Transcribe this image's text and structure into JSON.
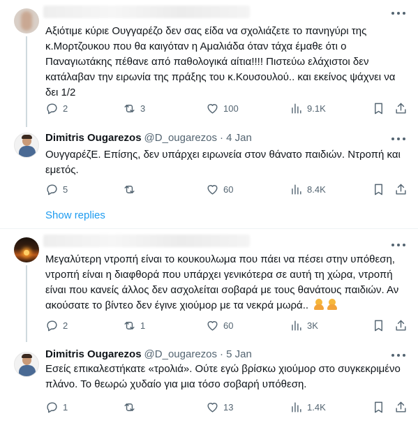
{
  "tweets": [
    {
      "name": "",
      "handle": "",
      "date": "",
      "text": "Αξιότιμε κύριε Ουγγαρέζο δεν σας είδα να σχολιάζετε το πανηγύρι της κ.Μορτζουκου που θα καιγόταν η Αμαλιάδα όταν τάχα έμαθε ότι ο Παναγιωτάκης πέθανε από παθολογικά αίτια!!!! Πιστεύω ελάχιστοι δεν κατάλαβαν την ειρωνία της πράξης του κ.Κουσουλού.. και εκείνος ψάχνει να δει 1/2",
      "replies": "2",
      "reposts": "3",
      "likes": "100",
      "views": "9.1K"
    },
    {
      "name": "Dimitris Ougarezos",
      "handle": "@D_ougarezos",
      "date": "· 4 Jan",
      "text": "ΟυγγαρέζΕ. Επίσης, δεν υπάρχει ειρωνεία στον θάνατο παιδιών. Ντροπή και εμετός.",
      "replies": "5",
      "reposts": "",
      "likes": "60",
      "views": "8.4K"
    },
    {
      "name": "",
      "handle": "",
      "date": "",
      "text": "Μεγαλύτερη ντροπή είναι το κουκουλωμα που πάει να πέσει στην υπόθεση, ντροπή είναι η διαφθορά που υπάρχει γενικότερα σε αυτή τη χώρα, ντροπή είναι που κανείς άλλος δεν ασχολείται σοβαρά με τους θανάτους παιδιών. Αν ακούσατε το βίντεο δεν έγινε χιούμορ με τα νεκρά μωρά..",
      "replies": "2",
      "reposts": "1",
      "likes": "60",
      "views": "3K"
    },
    {
      "name": "Dimitris Ougarezos",
      "handle": "@D_ougarezos",
      "date": "· 5 Jan",
      "text": "Εσείς επικαλεστήκατε «τρολιά». Ούτε εγώ βρίσκω χιούμορ στο συγκεκριμένο πλάνο. Το θεωρώ χυδαίο για μια τόσο σοβαρή υπόθεση.",
      "replies": "1",
      "reposts": "",
      "likes": "13",
      "views": "1.4K"
    }
  ],
  "show_replies": "Show replies",
  "icons": {
    "reply": "speech-bubble-icon",
    "repost": "repost-arrows-icon",
    "like": "heart-icon",
    "views": "bar-chart-icon",
    "bookmark": "bookmark-icon",
    "share": "share-upload-icon",
    "more": "more-dots-icon",
    "emoji": "person-gesturing-emoji"
  },
  "colors": {
    "link": "#1d9bf0",
    "secondary": "#536471",
    "text": "#0f1419",
    "thread_line": "#cfd9de"
  }
}
